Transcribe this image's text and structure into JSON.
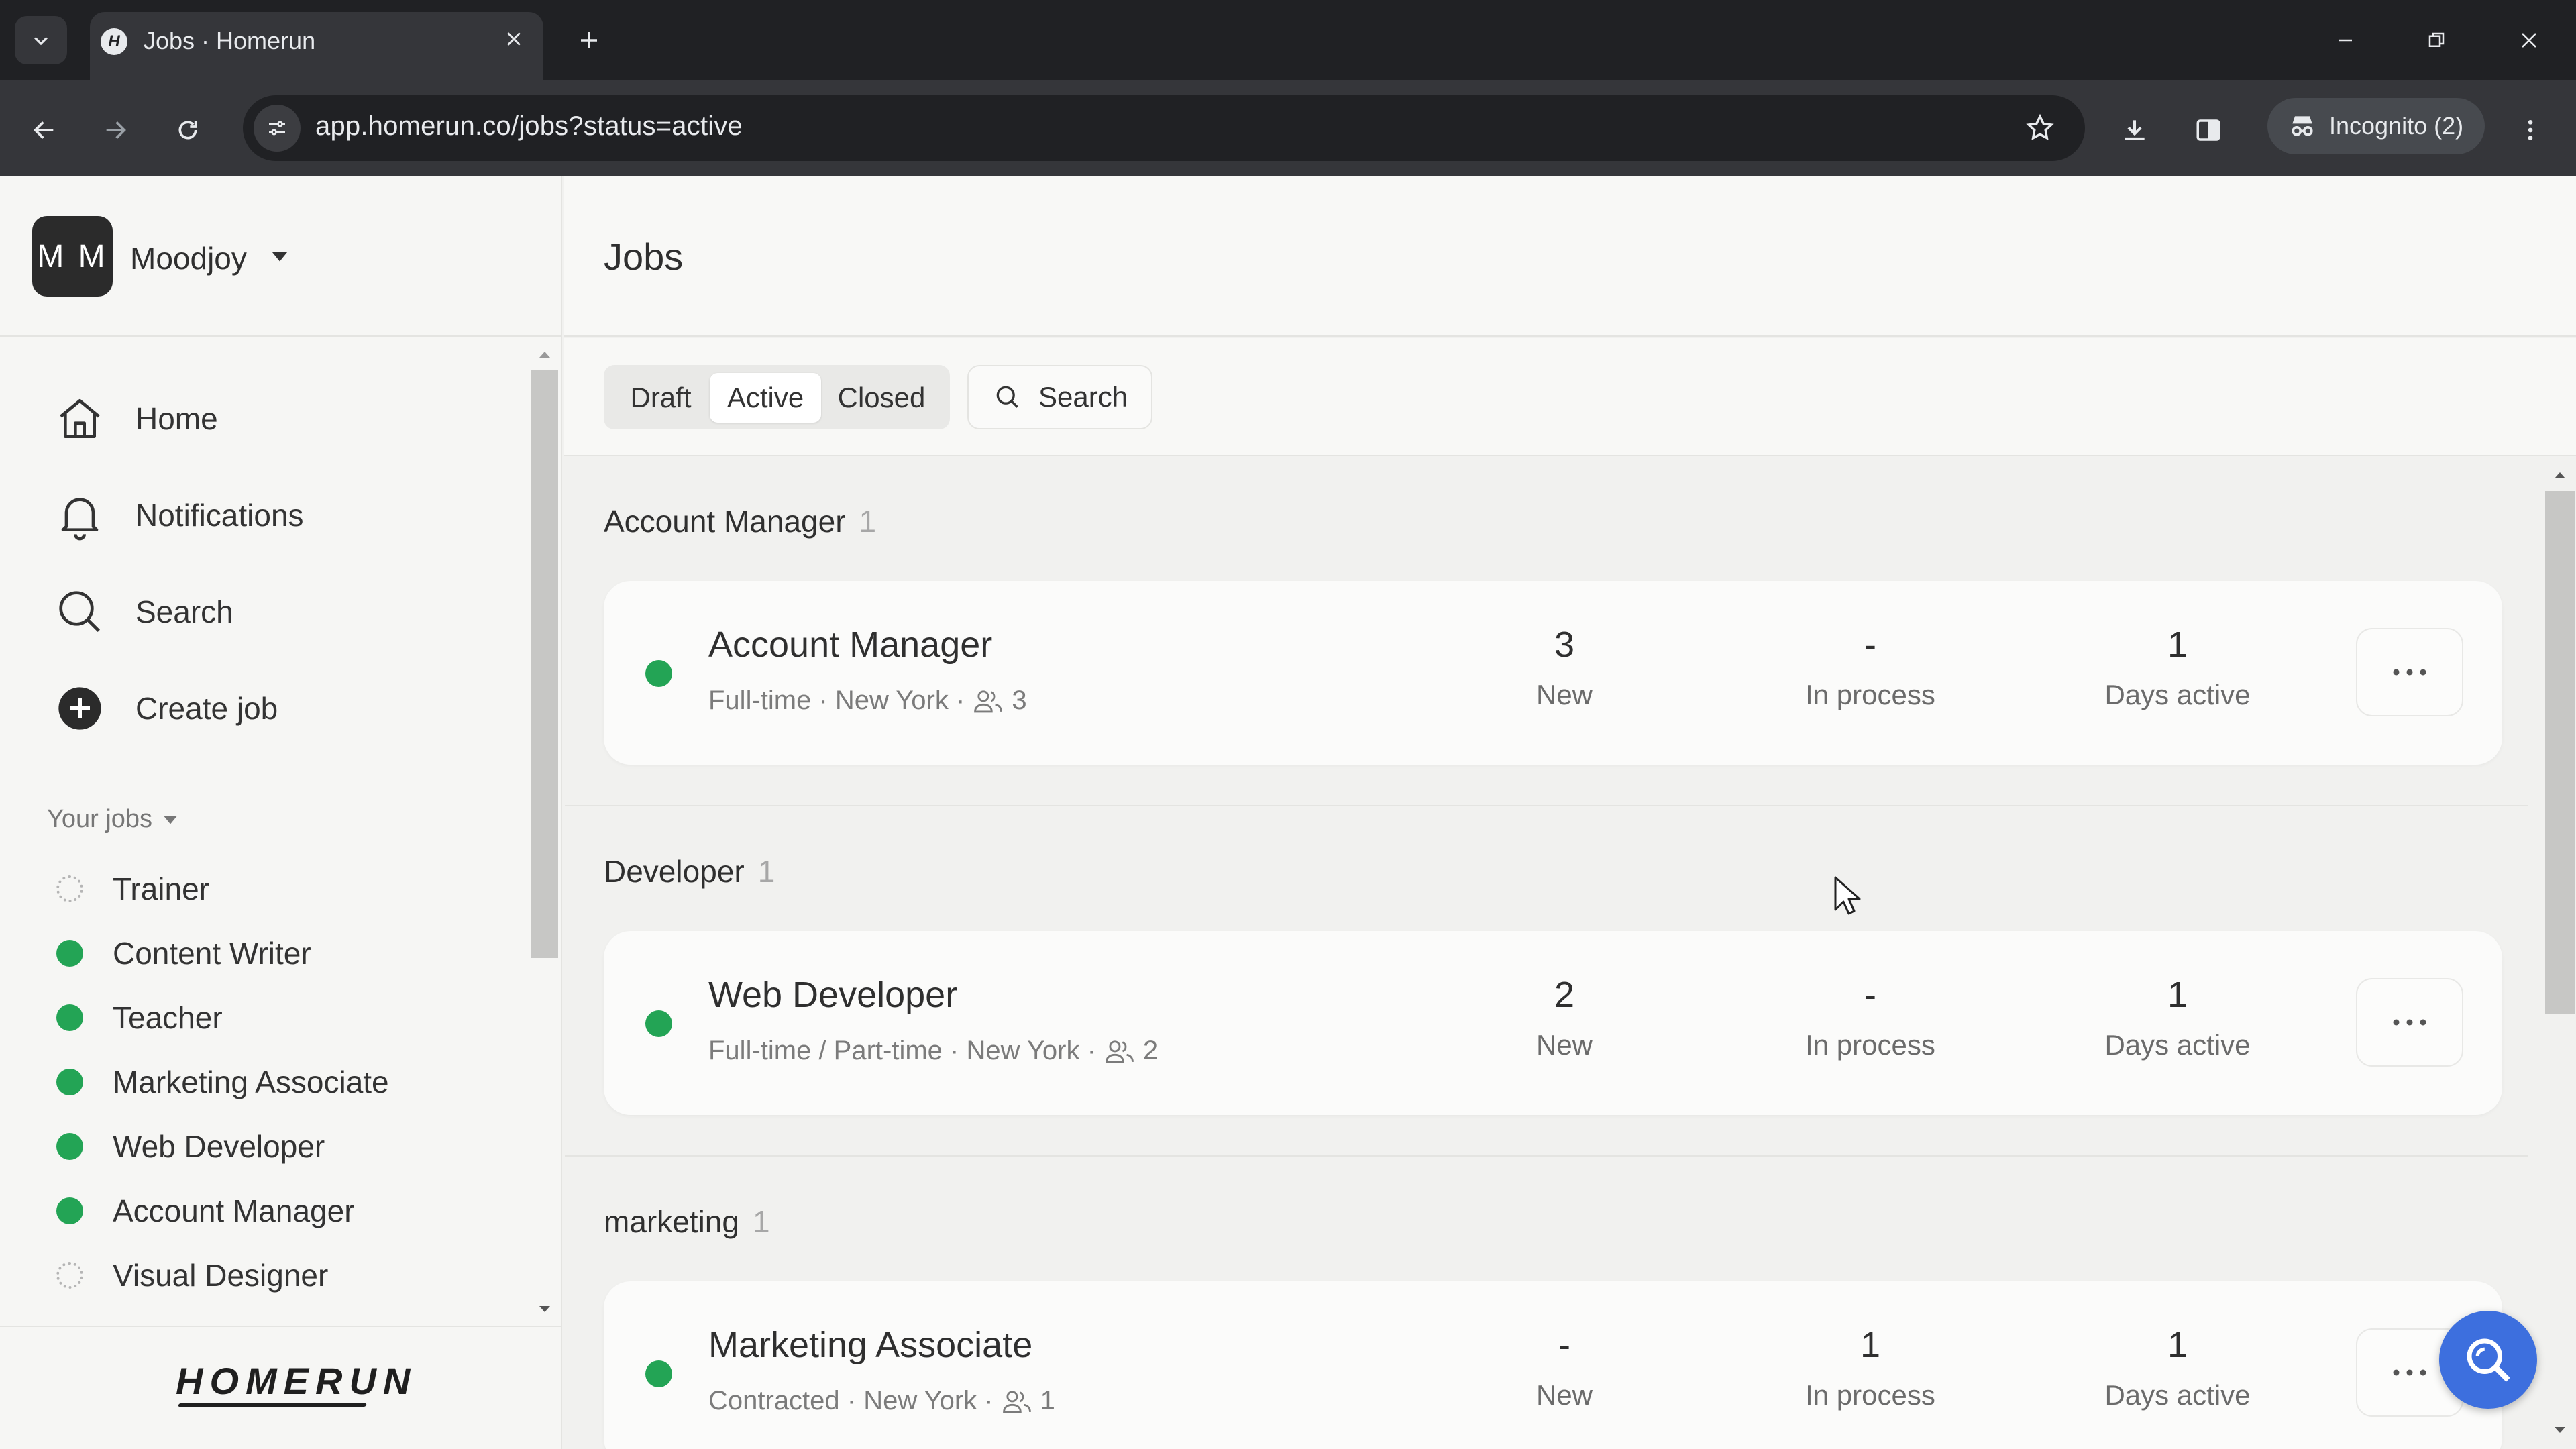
{
  "browser": {
    "tab_title": "Jobs · Homerun",
    "tab_favicon": "H",
    "url": "app.homerun.co/jobs?status=active",
    "incognito_label": "Incognito (2)"
  },
  "workspace": {
    "avatar_initials": "M M",
    "name": "Moodjoy"
  },
  "sidebar": {
    "nav": [
      {
        "label": "Home",
        "icon": "home-icon"
      },
      {
        "label": "Notifications",
        "icon": "bell-icon"
      },
      {
        "label": "Search",
        "icon": "search-icon"
      },
      {
        "label": "Create job",
        "icon": "plus-circle-icon"
      }
    ],
    "your_jobs_label": "Your jobs",
    "jobs": [
      {
        "label": "Trainer",
        "status": "draft"
      },
      {
        "label": "Content Writer",
        "status": "active"
      },
      {
        "label": "Teacher",
        "status": "active"
      },
      {
        "label": "Marketing Associate",
        "status": "active"
      },
      {
        "label": "Web Developer",
        "status": "active"
      },
      {
        "label": "Account Manager",
        "status": "active"
      },
      {
        "label": "Visual Designer",
        "status": "draft"
      }
    ],
    "logo": "HOMERUN"
  },
  "main": {
    "title": "Jobs",
    "filters": {
      "draft": "Draft",
      "active": "Active",
      "closed": "Closed",
      "selected": "Active"
    },
    "search_label": "Search",
    "groups": [
      {
        "name": "Account Manager",
        "count": "1",
        "job": {
          "title": "Account Manager",
          "meta": "Full-time · New York ·",
          "people": "3",
          "new": "3",
          "in_process": "-",
          "days_active": "1"
        }
      },
      {
        "name": "Developer",
        "count": "1",
        "job": {
          "title": "Web Developer",
          "meta": "Full-time / Part-time · New York ·",
          "people": "2",
          "new": "2",
          "in_process": "-",
          "days_active": "1"
        }
      },
      {
        "name": "marketing",
        "count": "1",
        "job": {
          "title": "Marketing Associate",
          "meta": "Contracted · New York ·",
          "people": "1",
          "new": "-",
          "in_process": "1",
          "days_active": "1"
        }
      }
    ],
    "stat_labels": {
      "new": "New",
      "in_process": "In process",
      "days_active": "Days active"
    }
  },
  "colors": {
    "active_dot": "#23a455",
    "chat_button": "#3d6fde",
    "chrome_dark": "#202124"
  }
}
